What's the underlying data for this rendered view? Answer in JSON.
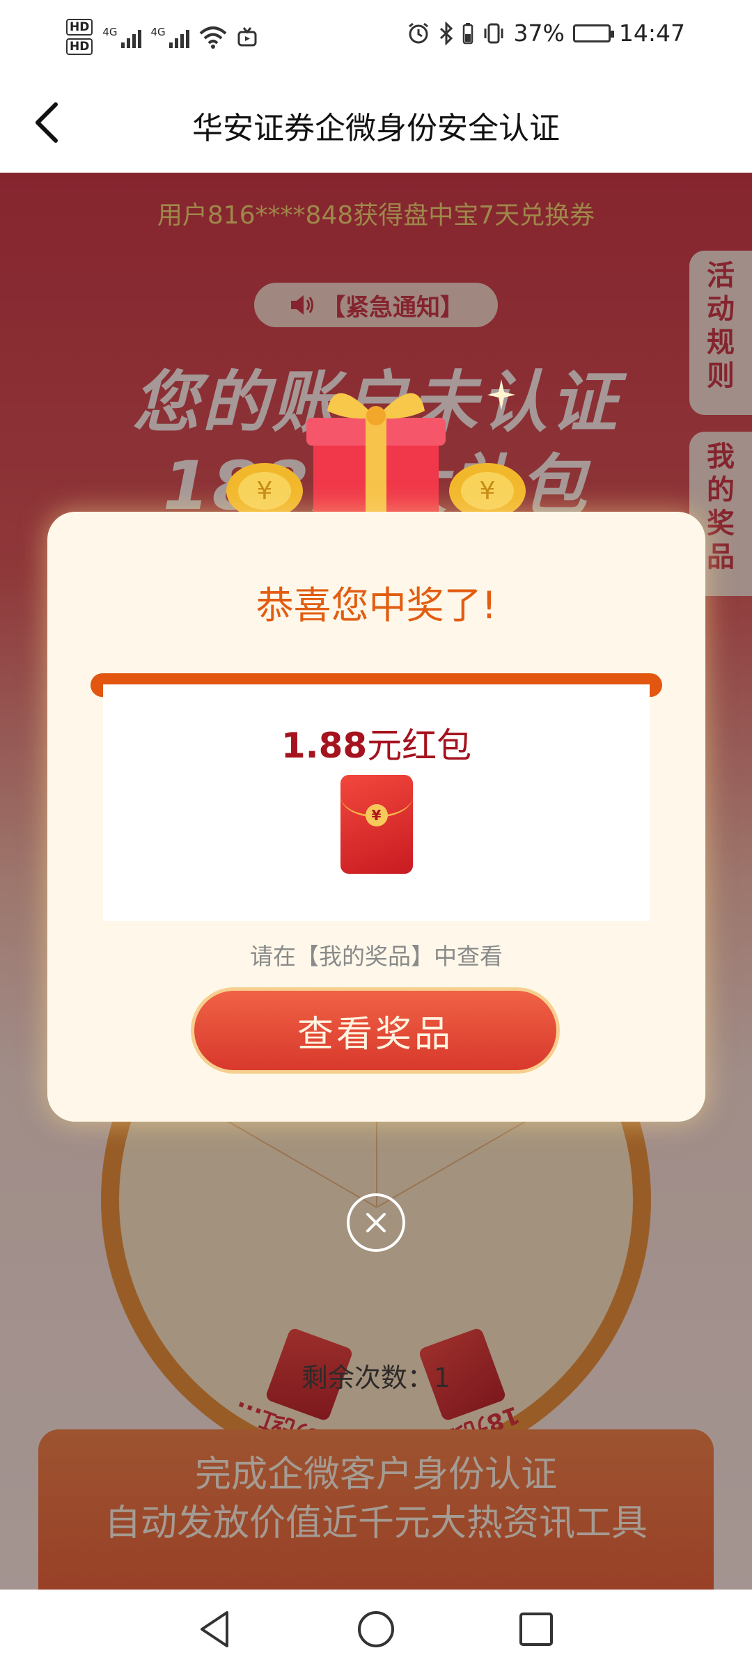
{
  "status_bar": {
    "hd1": "HD",
    "hd2": "HD",
    "net1": "4G",
    "net2": "4G",
    "battery_percent": "37%",
    "time": "14:47"
  },
  "nav": {
    "title": "华安证券企微身份安全认证"
  },
  "background": {
    "ticker": "用户816****848获得盘中宝7天兑换券",
    "notice": "【紧急通知】",
    "headline_1": "您的账户未认证",
    "headline_2": "188元大礼包",
    "side_tabs": {
      "rules": [
        "活",
        "动",
        "规",
        "则"
      ],
      "prizes": [
        "我",
        "的",
        "奖",
        "品"
      ]
    },
    "wheel_prizes": [
      "6.88元红...",
      "18元红包"
    ],
    "remaining": "剩余次数：1",
    "promo_line1": "完成企微客户身份认证",
    "promo_line2": "自动发放价值近千元大热资讯工具"
  },
  "dialog": {
    "title": "恭喜您中奖了!",
    "prize_amount": "1.88",
    "prize_unit": "元红包",
    "coin_symbol": "¥",
    "hint": "请在【我的奖品】中查看",
    "view_button": "查看奖品"
  },
  "colors": {
    "accent_orange": "#e2560f",
    "prize_red": "#a4131e",
    "ticker_gold": "#f3d46a"
  }
}
